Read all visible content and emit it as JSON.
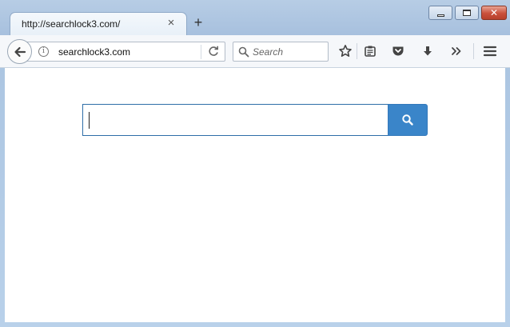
{
  "tab": {
    "title": "http://searchlock3.com/",
    "close_glyph": "×",
    "new_tab_glyph": "+"
  },
  "window_controls": {
    "close_glyph": "✕"
  },
  "urlbar": {
    "url": "searchlock3.com",
    "info_glyph": "i"
  },
  "searchbar": {
    "placeholder": "Search"
  },
  "page_search": {
    "value": ""
  },
  "icons": {
    "back": "back-arrow-icon",
    "reload": "reload-icon",
    "bookmark": "star-icon",
    "reader": "reading-list-icon",
    "pocket": "pocket-icon",
    "downloads": "download-icon",
    "overflow": "chevron-double-right-icon",
    "menu": "hamburger-menu-icon",
    "search": "magnifier-icon"
  },
  "colors": {
    "accent": "#3a85c9",
    "input_border": "#2f6ea8",
    "window_close": "#c9503b"
  }
}
